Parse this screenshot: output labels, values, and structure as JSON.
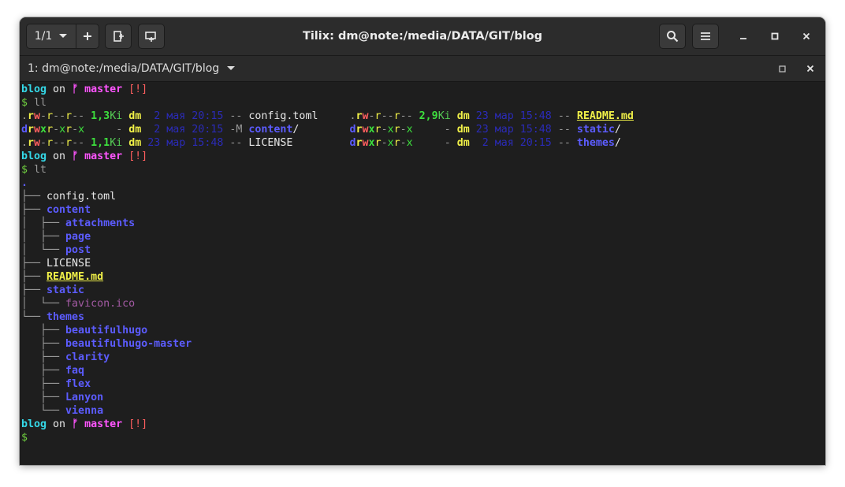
{
  "window": {
    "title": "Tilix: dm@note:/media/DATA/GIT/blog",
    "session_counter": "1/1"
  },
  "tab": {
    "title": "1: dm@note:/media/DATA/GIT/blog"
  },
  "icons": {
    "dropdown": "chevron-down-icon",
    "add": "plus-icon",
    "split_right": "split-horizontal-icon",
    "split_down": "split-vertical-icon",
    "search": "search-icon",
    "menu": "hamburger-menu-icon",
    "minimize": "minimize-icon",
    "maximize": "maximize-icon",
    "close": "close-icon"
  },
  "colors": {
    "terminal_bg": "#1e1e1e",
    "headerbar_bg": "#2c2c2c",
    "prompt_dir": "#35d9e8",
    "branch": "#ff55ff",
    "git_status": "#ff5f5f",
    "directory": "#5c5cff",
    "highlight_file": "#f0f048"
  },
  "prompt": {
    "dir": "blog",
    "on": "on",
    "branch_icon": "ᚠ",
    "branch": "master",
    "status": "[!]",
    "symbol": "$"
  },
  "commands": [
    "ll",
    "lt"
  ],
  "ll_entries": [
    {
      "perm": ".rw-r--r--",
      "size": "1,3",
      "unit": "Ki",
      "user": "dm",
      "date": " 2 мая 20:15",
      "git": "--",
      "name": "config.toml",
      "type": "file"
    },
    {
      "perm": ".rw-r--r--",
      "size": "2,9",
      "unit": "Ki",
      "user": "dm",
      "date": "23 мар 15:48",
      "git": "--",
      "name": "README.md",
      "type": "readme"
    },
    {
      "perm": "drwxr-xr-x",
      "size": "-",
      "unit": "",
      "user": "dm",
      "date": " 2 мая 20:15",
      "git": "-M",
      "name": "content",
      "type": "dir"
    },
    {
      "perm": "drwxr-xr-x",
      "size": "-",
      "unit": "",
      "user": "dm",
      "date": "23 мар 15:48",
      "git": "--",
      "name": "static",
      "type": "dir"
    },
    {
      "perm": ".rw-r--r--",
      "size": "1,1",
      "unit": "Ki",
      "user": "dm",
      "date": "23 мар 15:48",
      "git": "--",
      "name": "LICENSE",
      "type": "file"
    },
    {
      "perm": "drwxr-xr-x",
      "size": "-",
      "unit": "",
      "user": "dm",
      "date": " 2 мая 20:15",
      "git": "--",
      "name": "themes",
      "type": "dir"
    }
  ],
  "tree": {
    "root": ".",
    "lines": [
      {
        "prefix": "├── ",
        "name": "config.toml",
        "type": "file"
      },
      {
        "prefix": "├── ",
        "name": "content",
        "type": "dir"
      },
      {
        "prefix": "│  ├── ",
        "name": "attachments",
        "type": "dir"
      },
      {
        "prefix": "│  ├── ",
        "name": "page",
        "type": "dir"
      },
      {
        "prefix": "│  └── ",
        "name": "post",
        "type": "dir"
      },
      {
        "prefix": "├── ",
        "name": "LICENSE",
        "type": "file"
      },
      {
        "prefix": "├── ",
        "name": "README.md",
        "type": "readme"
      },
      {
        "prefix": "├── ",
        "name": "static",
        "type": "dir"
      },
      {
        "prefix": "│  └── ",
        "name": "favicon.ico",
        "type": "image"
      },
      {
        "prefix": "└── ",
        "name": "themes",
        "type": "dir"
      },
      {
        "prefix": "   ├── ",
        "name": "beautifulhugo",
        "type": "dir"
      },
      {
        "prefix": "   ├── ",
        "name": "beautifulhugo-master",
        "type": "dir"
      },
      {
        "prefix": "   ├── ",
        "name": "clarity",
        "type": "dir"
      },
      {
        "prefix": "   ├── ",
        "name": "faq",
        "type": "dir"
      },
      {
        "prefix": "   ├── ",
        "name": "flex",
        "type": "dir"
      },
      {
        "prefix": "   ├── ",
        "name": "Lanyon",
        "type": "dir"
      },
      {
        "prefix": "   └── ",
        "name": "vienna",
        "type": "dir"
      }
    ]
  }
}
